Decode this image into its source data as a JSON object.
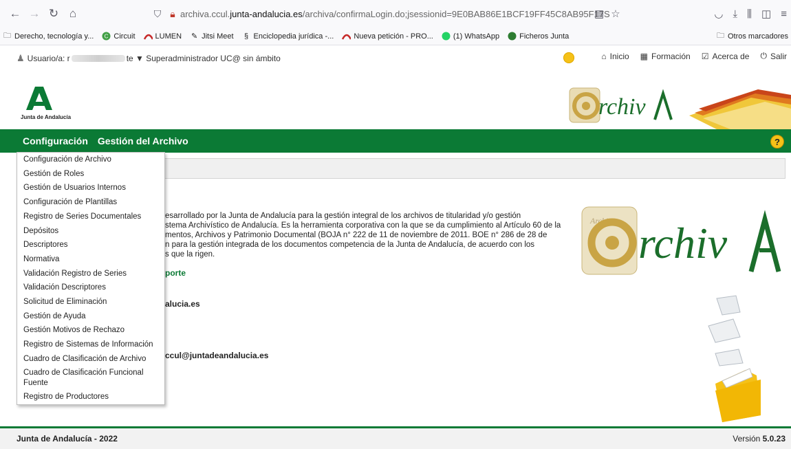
{
  "browser": {
    "url_prefix": "archiva.ccul.",
    "url_domain": "junta-andalucia.es",
    "url_suffix": "/archiva/confirmaLogin.do;jsessionid=9E0BAB86E1BCF19FF45C8AB95F17S",
    "icons": [
      "back-arrow-icon",
      "forward-arrow-icon",
      "reload-icon",
      "home-icon",
      "shield-icon",
      "lock-icon",
      "reader-icon",
      "star-icon",
      "pocket-icon",
      "download-icon",
      "library-icon",
      "sidebar-icon",
      "menu-icon"
    ]
  },
  "bookmarks": [
    {
      "label": "Derecho, tecnología y...",
      "icon": "folder-icon"
    },
    {
      "label": "Circuit",
      "icon": "circuit-icon"
    },
    {
      "label": "LUMEN",
      "icon": "lumen-icon"
    },
    {
      "label": "Jitsi Meet",
      "icon": "jitsi-icon"
    },
    {
      "label": "Enciclopedia jurídica -...",
      "icon": "section-icon"
    },
    {
      "label": "Nueva petición - PRO...",
      "icon": "lumen-icon"
    },
    {
      "label": "(1) WhatsApp",
      "icon": "whatsapp-icon"
    },
    {
      "label": "Ficheros Junta",
      "icon": "ficheros-icon"
    }
  ],
  "bookmarks_other": "Otros marcadores",
  "userbar": {
    "user_prefix": "Usuario/a: r",
    "user_suffix": "te ▼ Superadministrador UC@ sin ámbito"
  },
  "top_links": {
    "inicio": "Inicio",
    "formacion": "Formación",
    "acerca": "Acerca de",
    "salir": "Salir"
  },
  "header": {
    "logo_text": "Junta de Andalucía",
    "app_logo": "rchiv"
  },
  "menu": {
    "configuracion": "Configuración",
    "gestion": "Gestión del Archivo",
    "help": "?"
  },
  "dropdown": [
    "Configuración de Archivo",
    "Gestión de Roles",
    "Gestión de Usuarios Internos",
    "Configuración de Plantillas",
    "Registro de Series Documentales",
    "Depósitos",
    "Descriptores",
    "Normativa",
    "Validación Registro de Series",
    "Validación Descriptores",
    "Solicitud de Eliminación",
    "Gestión de Ayuda",
    "Gestión Motivos de Rechazo",
    "Registro de Sistemas de Información",
    "Cuadro de Clasificación de Archivo",
    "Cuadro de Clasificación Funcional Fuente",
    "Registro de Productores"
  ],
  "content": {
    "intro_lines": [
      "esarrollado por la Junta de Andalucía para la gestión integral de los archivos de titularidad y/o gestión",
      "stema Archivístico de Andalucía. Es la herramienta corporativa con la que se da cumplimiento al Artículo 60 de la",
      "mentos, Archivos y Patrimonio Documental (BOJA n° 222 de 11 de noviembre de 2011. BOE n° 286 de 28 de",
      "n para la gestión integrada de los documentos competencia de la Junta de Andalucía, de acuerdo con los",
      "s que la rigen."
    ],
    "soporte": "porte",
    "email1": "alucia.es",
    "email2": "ccul@juntadeandalucia.es"
  },
  "footer": {
    "left": "Junta de Andalucía - 2022",
    "version_label": "Versión ",
    "version": "5.0.23"
  },
  "colors": {
    "green": "#0b7a35",
    "yellow": "#f5c118"
  }
}
